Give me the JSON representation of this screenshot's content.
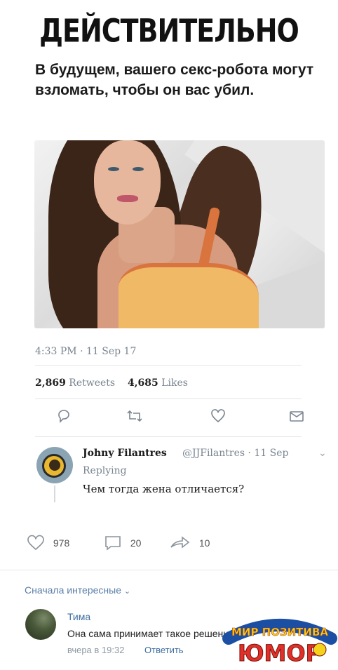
{
  "meme": {
    "headline": "ДЕЙСТВИТЕЛЬНО",
    "tweet_text": "В будущем, вашего секс-робота могут взломать, чтобы он вас убил.",
    "timestamp": "4:33 PM · 11 Sep 17",
    "retweets_count": "2,869",
    "retweets_label": "Retweets",
    "likes_count": "4,685",
    "likes_label": "Likes",
    "icons": [
      "reply-icon",
      "retweet-icon",
      "like-icon",
      "message-icon"
    ]
  },
  "reply": {
    "name": "Johny Filantres",
    "handle": "@JJFilantres · 11 Sep",
    "replying": "Replying",
    "text": "Чем тогда жена отличается?"
  },
  "post_actions": {
    "likes": "978",
    "comments": "20",
    "shares": "10"
  },
  "comments": {
    "sort_label": "Сначала интересные",
    "items": [
      {
        "author": "Тима",
        "text": "Она сама принимает такое решение",
        "time": "вчера в 19:32",
        "reply_label": "Ответить"
      }
    ]
  },
  "watermark": {
    "line1": "МИР ПОЗИТИВА",
    "line2": "ЮМОР"
  },
  "colors": {
    "link": "#3e6ea1",
    "muted": "#7a8590",
    "logo_yellow": "#f5d21c",
    "logo_red": "#e0302a"
  }
}
